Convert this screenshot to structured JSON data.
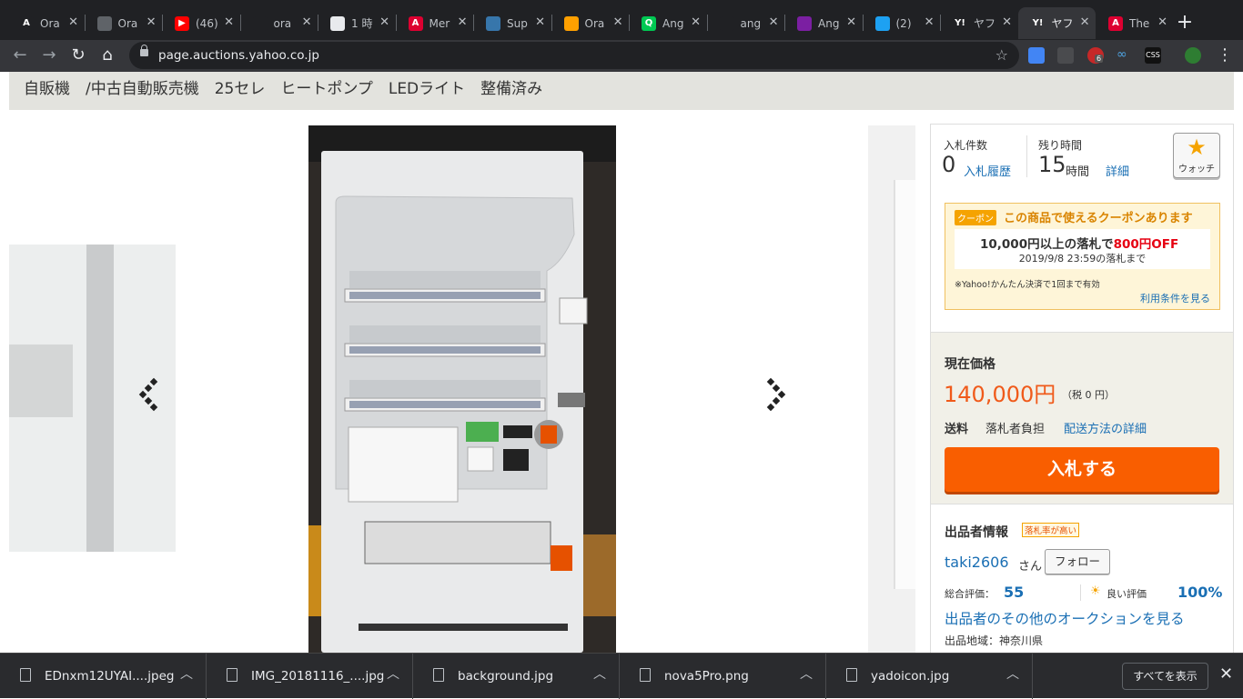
{
  "browser": {
    "tabs": [
      {
        "label": "Ora",
        "fav": "A",
        "favbg": "#202124"
      },
      {
        "label": "Ora",
        "fav": "",
        "favbg": "#5f6368"
      },
      {
        "label": "(46)",
        "fav": "▶",
        "favbg": "#ff0000"
      },
      {
        "label": "ora",
        "fav": "",
        "favbg": "#202124"
      },
      {
        "label": "1 時",
        "fav": "",
        "favbg": "#e8eaed"
      },
      {
        "label": "Mer",
        "fav": "A",
        "favbg": "#dd0031"
      },
      {
        "label": "Sup",
        "fav": "",
        "favbg": "#3776ab"
      },
      {
        "label": "Ora",
        "fav": "",
        "favbg": "#ffa000"
      },
      {
        "label": "Ang",
        "fav": "Q",
        "favbg": "#00c853"
      },
      {
        "label": "ang",
        "fav": "",
        "favbg": "#202124"
      },
      {
        "label": "Ang",
        "fav": "",
        "favbg": "#7b1fa2"
      },
      {
        "label": "(2)",
        "fav": "",
        "favbg": "#1da1f2"
      },
      {
        "label": "ヤフ",
        "fav": "Y!",
        "favbg": "#202124"
      },
      {
        "label": "ヤフ",
        "fav": "Y!",
        "favbg": "#35363a"
      },
      {
        "label": "The",
        "fav": "A",
        "favbg": "#dd0031"
      }
    ],
    "active_tab_index": 13,
    "url": "page.auctions.yahoo.co.jp",
    "new_tab_symbol": "+",
    "extension_badge": "6"
  },
  "page": {
    "title": "自販機　/中古自動販売機　25セレ　ヒートポンプ　LEDライト　整備済み",
    "bid_count_label": "入札件数",
    "bid_count": "0",
    "bid_history_link": "入札履歴",
    "time_left_label": "残り時間",
    "time_left_value": "15",
    "time_left_unit": "時間",
    "detail_link": "詳細",
    "watch_label": "ウォッチ",
    "coupon": {
      "badge": "クーポン",
      "headline": "この商品で使えるクーポンあります",
      "condition_prefix": "10,000円以上の落札で",
      "discount": "800円OFF",
      "deadline": "2019/9/8 23:59の落札まで",
      "note": "※Yahoo!かんたん決済で1回まで有効",
      "terms_link": "利用条件を見る"
    },
    "price": {
      "label": "現在価格",
      "value": "140,000円",
      "tax": "（税 0 円）",
      "shipping_label": "送料",
      "shipping_value": "落札者負担",
      "shipping_link": "配送方法の詳細",
      "bid_button": "入札する"
    },
    "seller": {
      "heading": "出品者情報",
      "badge": "落札率が高い",
      "name": "taki2606",
      "honorific": "さん",
      "follow_button": "フォロー",
      "rating_label": "総合評価：",
      "rating_value": "55",
      "good_label": "良い評価",
      "good_value": "100%",
      "other_auctions_link": "出品者のその他のオークションを見る",
      "region": "出品地域：神奈川県"
    }
  },
  "downloads": {
    "items": [
      {
        "name": "EDnxm12UYAI....jpeg"
      },
      {
        "name": "IMG_20181116_....jpg"
      },
      {
        "name": "background.jpg"
      },
      {
        "name": "nova5Pro.png"
      },
      {
        "name": "yadoicon.jpg"
      }
    ],
    "show_all": "すべてを表示"
  },
  "colors": {
    "accent_orange": "#f95e00",
    "price_orange": "#f05a1a",
    "link_blue": "#1a6fb4",
    "coupon_red": "#e60012"
  }
}
